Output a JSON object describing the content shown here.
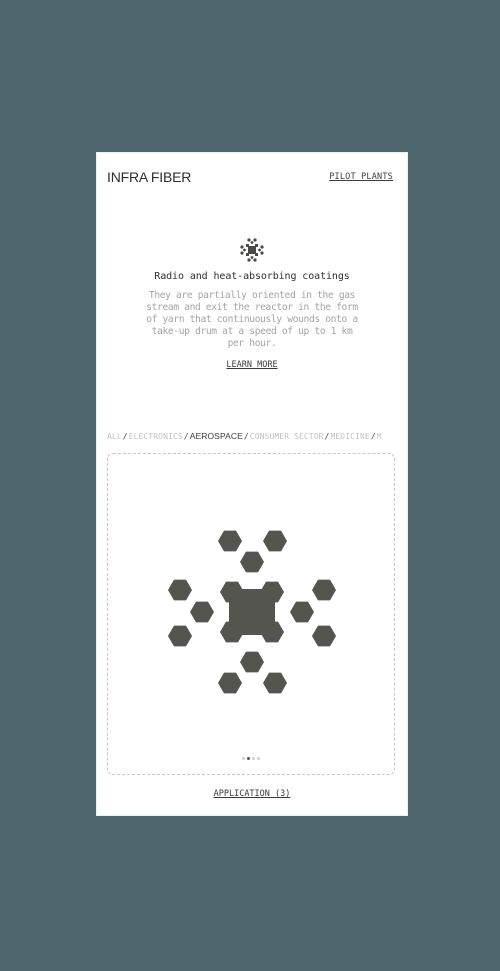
{
  "header": {
    "brand": "INFRA FIBER",
    "nav_link": "PILOT PLANTS"
  },
  "feature": {
    "icon": "molecule-icon",
    "title": "Radio and heat-absorbing coatings",
    "description": "They are partially oriented in the gas stream and exit the reactor in the form of yarn that continuously wounds onto a take-up drum at a speed of up to 1 km per hour.",
    "link": "LEARN MORE"
  },
  "filters": {
    "items": [
      "ALL",
      "ELECTRONICS",
      "AEROSPACE",
      "CONSUMER SECTOR",
      "MEDICINE",
      "M"
    ],
    "separator": "/",
    "active": "AEROSPACE"
  },
  "carousel": {
    "illustration": "hexagon-cluster-icon",
    "active_slide": 2,
    "slide_count": 4
  },
  "application_link": "APPLICATION (3)",
  "colors": {
    "background": "#4f666d",
    "screen": "#ffffff",
    "shape": "#555550",
    "muted_text": "#a4a4a4"
  }
}
